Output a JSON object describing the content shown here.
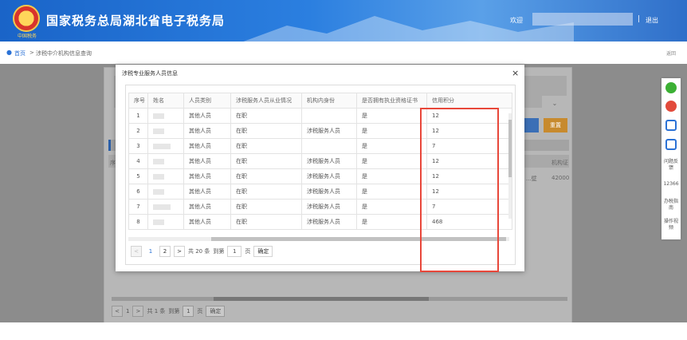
{
  "header": {
    "title": "国家税务总局湖北省电子税务局",
    "emblem_sub": "中国税务",
    "welcome": "欢迎",
    "separator": "|",
    "logout": "退出",
    "colors": {
      "primary": "#1a64c8",
      "accent": "#2b72d6"
    }
  },
  "breadcrumb": {
    "home": "首页",
    "separator": ">",
    "current": "涉税中介机构信息查询",
    "back": "返回"
  },
  "background_panel": {
    "select_arrow": "⌄",
    "reset_label": "重置",
    "column_left": "序",
    "column_right": "机构证",
    "row_value_left": "...壁",
    "row_value_right": "42000",
    "pager": {
      "prev": "<",
      "page": "1",
      "next": ">",
      "total": "共 1 条",
      "goto": "到第",
      "page_input": "1",
      "page_unit": "页",
      "confirm": "确定"
    }
  },
  "right_bar": {
    "items": [
      {
        "icon": "wechat-icon",
        "color": "#3cb034"
      },
      {
        "icon": "weibo-icon",
        "color": "#e24a3b"
      },
      {
        "icon": "app-icon",
        "color": "#2b72d6"
      },
      {
        "icon": "app-icon",
        "color": "#2b72d6"
      },
      {
        "label": "问题反馈"
      },
      {
        "label": "12366"
      },
      {
        "label": "办税指南"
      },
      {
        "label": "操作视频"
      }
    ]
  },
  "modal": {
    "title": "涉税专业服务人员信息",
    "close": "×",
    "columns": [
      "序号",
      "姓名",
      "人员类别",
      "涉税服务人员从业情况",
      "机构内身份",
      "是否拥有执业资格证书",
      "信用积分"
    ],
    "rows": [
      {
        "no": "1",
        "type": "其他人员",
        "status": "在职",
        "role": "",
        "cert": "是",
        "score": "12"
      },
      {
        "no": "2",
        "type": "其他人员",
        "status": "在职",
        "role": "涉税服务人员",
        "cert": "是",
        "score": "12"
      },
      {
        "no": "3",
        "type": "其他人员",
        "status": "在职",
        "role": "",
        "cert": "是",
        "score": "7"
      },
      {
        "no": "4",
        "type": "其他人员",
        "status": "在职",
        "role": "涉税服务人员",
        "cert": "是",
        "score": "12"
      },
      {
        "no": "5",
        "type": "其他人员",
        "status": "在职",
        "role": "涉税服务人员",
        "cert": "是",
        "score": "12"
      },
      {
        "no": "6",
        "type": "其他人员",
        "status": "在职",
        "role": "涉税服务人员",
        "cert": "是",
        "score": "12"
      },
      {
        "no": "7",
        "type": "其他人员",
        "status": "在职",
        "role": "涉税服务人员",
        "cert": "是",
        "score": "7"
      },
      {
        "no": "8",
        "type": "其他人员",
        "status": "在职",
        "role": "涉税服务人员",
        "cert": "是",
        "score": "468"
      }
    ],
    "pager": {
      "prev": "<",
      "pages": [
        "1",
        "2"
      ],
      "next": ">",
      "total": "共 20 条",
      "goto": "到第",
      "page_input": "1",
      "page_unit": "页",
      "confirm": "确定"
    },
    "highlight_color": "#e8473a"
  }
}
